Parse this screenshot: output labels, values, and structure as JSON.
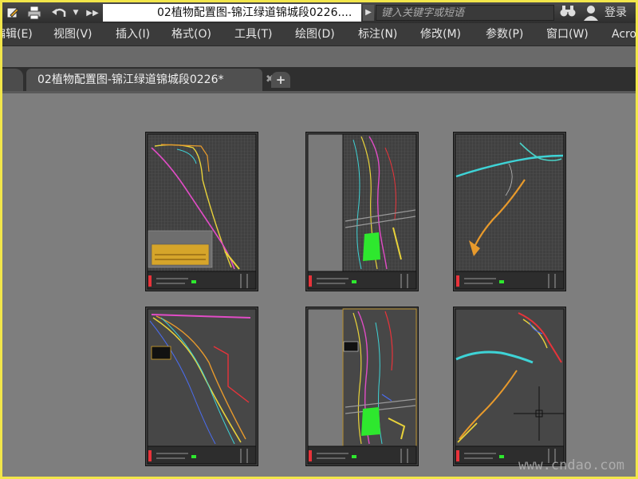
{
  "window": {
    "title": "02植物配置图-锦江绿道锦城段0226....",
    "search_placeholder": "键入关键字或短语",
    "login_label": "登录"
  },
  "quick_access": [
    {
      "icon": "edit-icon"
    },
    {
      "icon": "print-icon"
    },
    {
      "icon": "undo-icon"
    },
    {
      "icon": "dropdown-arrow-icon"
    },
    {
      "icon": "more-icon"
    }
  ],
  "menu": [
    {
      "label": "编辑(E)"
    },
    {
      "label": "视图(V)"
    },
    {
      "label": "插入(I)"
    },
    {
      "label": "格式(O)"
    },
    {
      "label": "工具(T)"
    },
    {
      "label": "绘图(D)"
    },
    {
      "label": "标注(N)"
    },
    {
      "label": "修改(M)"
    },
    {
      "label": "参数(P)"
    },
    {
      "label": "窗口(W)"
    },
    {
      "label": "Acro"
    }
  ],
  "tabs": [
    {
      "label": "02植物配置图-锦江绿道锦城段0226*",
      "active": true
    }
  ],
  "watermark": "www.cndao.com",
  "colors": {
    "canvas": "#7e7e7e",
    "sheet_background": "#3c3c3c",
    "frame": "#101010",
    "grid": "#5d5d5d",
    "yellow": "#e8d23a",
    "red": "#e8333a",
    "magenta": "#e14cc6",
    "cyan": "#3ed3d6",
    "green": "#2ee82e",
    "orange": "#e89a2c",
    "blue": "#4a6cf0"
  }
}
